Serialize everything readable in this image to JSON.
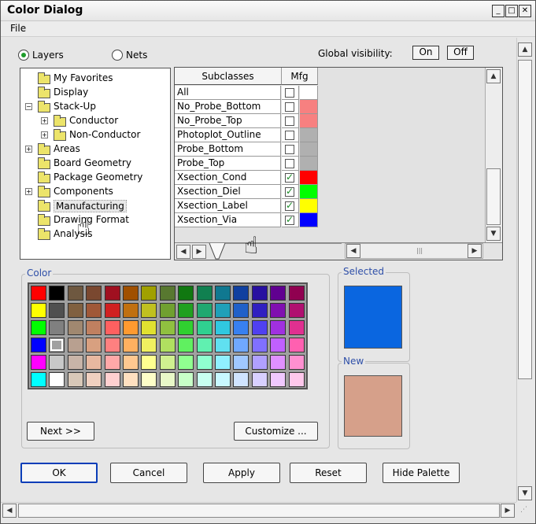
{
  "window": {
    "title": "Color Dialog",
    "controls": [
      "_",
      "□",
      "✕"
    ]
  },
  "menu": {
    "file": "File"
  },
  "mode": {
    "layers": "Layers",
    "nets": "Nets",
    "selected": "layers"
  },
  "global_visibility": {
    "label": "Global visibility:",
    "on": "On",
    "off": "Off"
  },
  "tree": {
    "items": [
      {
        "label": "My Favorites",
        "level": 0,
        "expander": ""
      },
      {
        "label": "Display",
        "level": 0,
        "expander": ""
      },
      {
        "label": "Stack-Up",
        "level": 0,
        "expander": "−"
      },
      {
        "label": "Conductor",
        "level": 1,
        "expander": "+"
      },
      {
        "label": "Non-Conductor",
        "level": 1,
        "expander": "+"
      },
      {
        "label": "Areas",
        "level": 0,
        "expander": "+"
      },
      {
        "label": "Board Geometry",
        "level": 0,
        "expander": ""
      },
      {
        "label": "Package Geometry",
        "level": 0,
        "expander": ""
      },
      {
        "label": "Components",
        "level": 0,
        "expander": "+"
      },
      {
        "label": "Manufacturing",
        "level": 0,
        "expander": "",
        "selected": true
      },
      {
        "label": "Drawing Format",
        "level": 0,
        "expander": ""
      },
      {
        "label": "Analysis",
        "level": 0,
        "expander": ""
      }
    ]
  },
  "grid": {
    "headers": {
      "subclasses": "Subclasses",
      "mfg": "Mfg"
    },
    "rows": [
      {
        "name": "All",
        "checked": false,
        "color": "#ffffff"
      },
      {
        "name": "No_Probe_Bottom",
        "checked": false,
        "color": "#f78080"
      },
      {
        "name": "No_Probe_Top",
        "checked": false,
        "color": "#f78080"
      },
      {
        "name": "Photoplot_Outline",
        "checked": false,
        "color": "#b0b0b0"
      },
      {
        "name": "Probe_Bottom",
        "checked": false,
        "color": "#b0b0b0"
      },
      {
        "name": "Probe_Top",
        "checked": false,
        "color": "#b0b0b0"
      },
      {
        "name": "Xsection_Cond",
        "checked": true,
        "color": "#ff0000"
      },
      {
        "name": "Xsection_Diel",
        "checked": true,
        "color": "#00ff00"
      },
      {
        "name": "Xsection_Label",
        "checked": true,
        "color": "#ffff00"
      },
      {
        "name": "Xsection_Via",
        "checked": true,
        "color": "#0000ff"
      }
    ]
  },
  "color_group": {
    "label": "Color",
    "palette": [
      [
        "#ff0000",
        "#000000",
        "#6e5840",
        "#7a4830",
        "#a01020",
        "#a05000",
        "#a0a000",
        "#587830",
        "#107810",
        "#108050",
        "#107890",
        "#1040a0",
        "#2810a0",
        "#600090",
        "#900050"
      ],
      [
        "#ffff00",
        "#505050",
        "#806040",
        "#a05838",
        "#d02020",
        "#c07010",
        "#c0c020",
        "#70a030",
        "#20a020",
        "#20a870",
        "#20a0b8",
        "#2060c8",
        "#3020c0",
        "#8010b0",
        "#b01070"
      ],
      [
        "#00ff00",
        "#808080",
        "#a08870",
        "#c08060",
        "#ff6060",
        "#ff9a30",
        "#e0e030",
        "#90c040",
        "#30d030",
        "#30d090",
        "#30c8e0",
        "#3880f0",
        "#5040f0",
        "#a030e0",
        "#e03090"
      ],
      [
        "#0000ff",
        "#a0a0a0",
        "#b8a090",
        "#d8a080",
        "#ff8080",
        "#ffb060",
        "#f0f060",
        "#b0e060",
        "#60f060",
        "#60f0b0",
        "#60e0f0",
        "#70a8ff",
        "#8070ff",
        "#c060ff",
        "#ff60b0"
      ],
      [
        "#ff00ff",
        "#c8c8c8",
        "#c8b4a8",
        "#e8b8a0",
        "#ffa8a8",
        "#ffc890",
        "#ffff90",
        "#d0f090",
        "#90ff90",
        "#90ffd0",
        "#90f0ff",
        "#a0c8ff",
        "#b0a0ff",
        "#e090ff",
        "#ff90d0"
      ],
      [
        "#00ffff",
        "#ffffff",
        "#d8c8b8",
        "#f0d0c0",
        "#ffd0d0",
        "#ffe0c0",
        "#ffffc8",
        "#e8f8c8",
        "#c8ffc8",
        "#c8fff0",
        "#c8f8ff",
        "#d0e4ff",
        "#d8d0ff",
        "#f0c8ff",
        "#ffc8ec"
      ]
    ],
    "selected_cell": [
      3,
      1
    ],
    "next_label": "Next >>",
    "customize_label": "Customize ..."
  },
  "selected_group": {
    "label": "Selected",
    "color": "#0a66e0"
  },
  "new_group": {
    "label": "New",
    "color": "#d6a08a"
  },
  "buttons": {
    "ok": "OK",
    "cancel": "Cancel",
    "apply": "Apply",
    "reset": "Reset",
    "hide_palette": "Hide Palette"
  }
}
